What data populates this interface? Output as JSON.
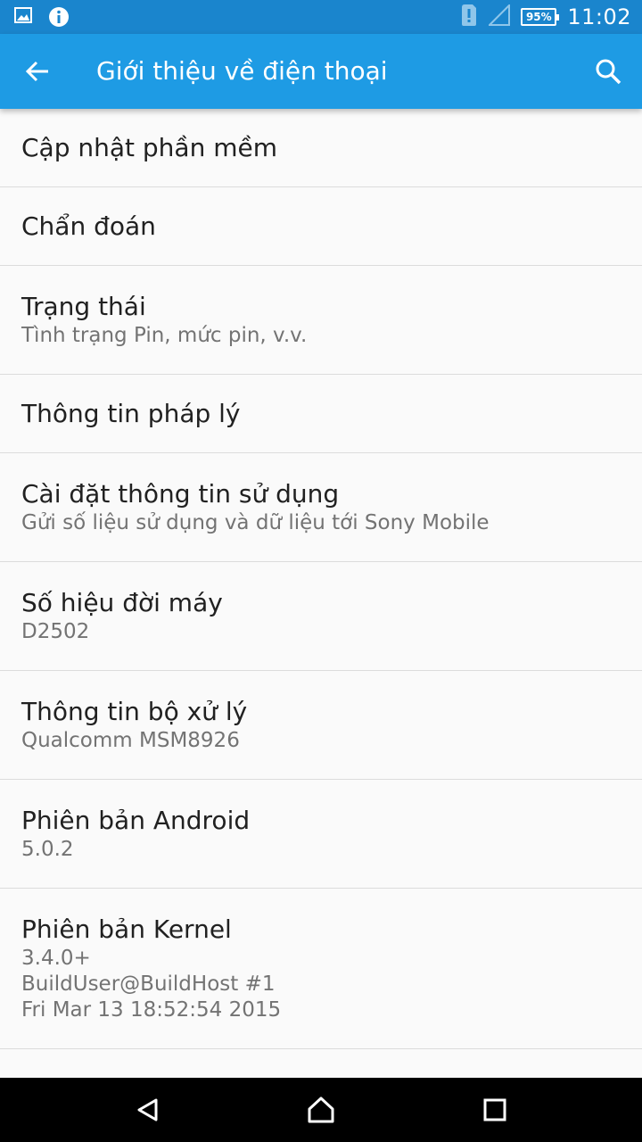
{
  "status_bar": {
    "time": "11:02",
    "battery": "95%",
    "icons": [
      "image-notification-icon",
      "info-notification-icon",
      "sim-alert-icon",
      "signal-icon",
      "battery-icon"
    ]
  },
  "app_bar": {
    "title": "Giới thiệu về điện thoại",
    "back_icon": "arrow-back-icon",
    "search_icon": "search-icon"
  },
  "items": [
    {
      "title": "Cập nhật phần mềm",
      "subtitle": ""
    },
    {
      "title": "Chẩn đoán",
      "subtitle": ""
    },
    {
      "title": "Trạng thái",
      "subtitle": "Tình trạng Pin, mức pin, v.v."
    },
    {
      "title": "Thông tin pháp lý",
      "subtitle": ""
    },
    {
      "title": "Cài đặt thông tin sử dụng",
      "subtitle": "Gửi số liệu sử dụng và dữ liệu tới Sony Mobile"
    },
    {
      "title": "Số hiệu đời máy",
      "subtitle": "D2502"
    },
    {
      "title": "Thông tin bộ xử lý",
      "subtitle": "Qualcomm MSM8926"
    },
    {
      "title": "Phiên bản Android",
      "subtitle": "5.0.2"
    },
    {
      "title": "Phiên bản Kernel",
      "subtitle": "3.4.0+\nBuildUser@BuildHost #1\nFri Mar 13 18:52:54 2015"
    }
  ],
  "nav_bar": {
    "icons": [
      "back-triangle-icon",
      "home-icon",
      "recents-square-icon"
    ]
  },
  "colors": {
    "status_bar": "#1a85cd",
    "app_bar": "#1e9be4",
    "background": "#fafafa",
    "divider": "#dcdcdc"
  }
}
